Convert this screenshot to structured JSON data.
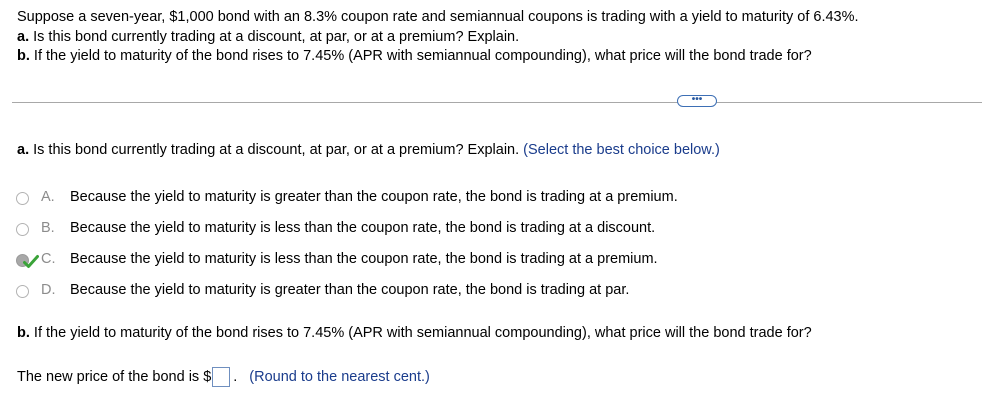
{
  "question": {
    "line1": "Suppose a seven-year, $1,000 bond with an 8.3% coupon rate and semiannual coupons is trading with a yield to maturity of 6.43%.",
    "line2_bold": "a.",
    "line2_text": " Is this bond currently trading at a discount, at par, or at a premium? Explain.",
    "line3_bold": "b.",
    "line3_text": " If the yield to maturity of the bond rises to 7.45% (APR with semiannual compounding), what price will the bond trade for?"
  },
  "more_button": {
    "label": "•••",
    "icon": "ellipsis-icon"
  },
  "part_a": {
    "label": "a.",
    "prompt": " Is this bond currently trading at a discount, at par, or at a premium? Explain.",
    "hint": "(Select the best choice below.)",
    "choices": [
      {
        "letter": "A.",
        "text": "Because the yield to maturity is greater than the coupon rate, the bond is trading at a premium.",
        "selected": false
      },
      {
        "letter": "B.",
        "text": "Because the yield to maturity is less than the coupon rate, the bond is trading at a discount.",
        "selected": false
      },
      {
        "letter": "C.",
        "text": "Because the yield to maturity is less than the coupon rate, the bond is trading at a premium.",
        "selected": true,
        "correct": true
      },
      {
        "letter": "D.",
        "text": "Because the yield to maturity is greater than the coupon rate, the bond is trading at par.",
        "selected": false
      }
    ]
  },
  "part_b": {
    "label": "b.",
    "prompt": " If the yield to maturity of the bond rises to 7.45% (APR with semiannual compounding), what price will the bond trade for?",
    "answer_prefix": "The new price of the bond is $",
    "answer_value": "",
    "answer_suffix": ".",
    "hint": "(Round to the nearest cent.)"
  },
  "colors": {
    "hint": "#1a3c8c",
    "check": "#3aa339",
    "divider": "#a8a8a8",
    "button_border": "#3d6fb5"
  }
}
